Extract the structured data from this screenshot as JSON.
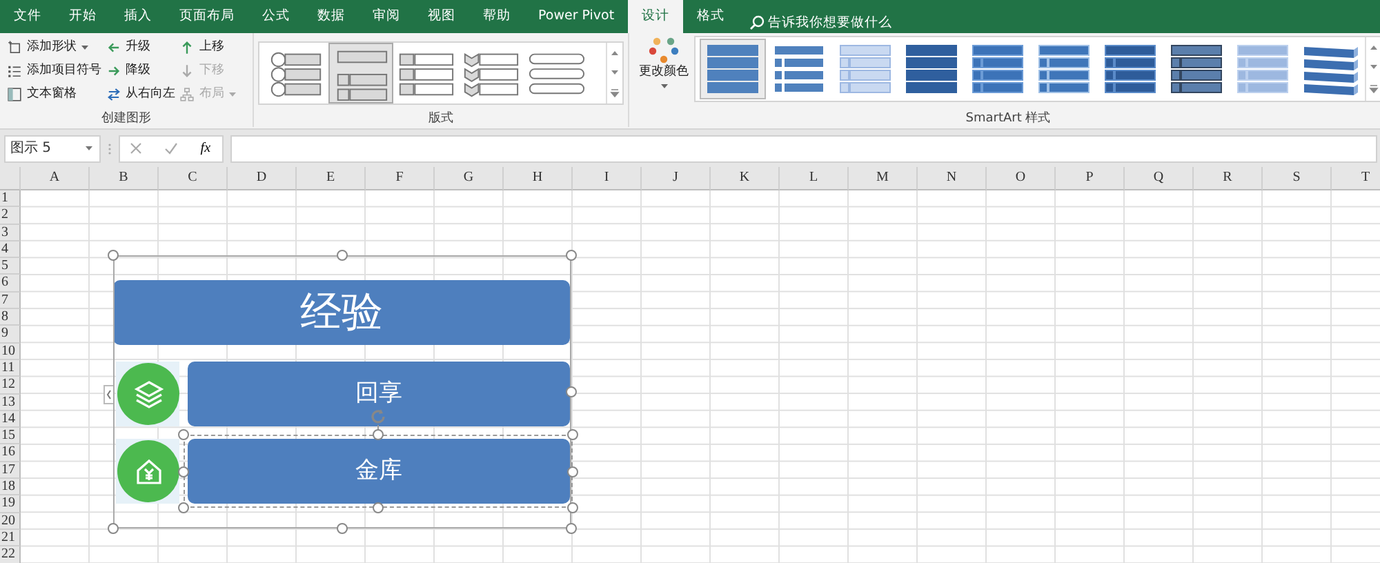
{
  "tabs": [
    {
      "label": "文件",
      "selected": false
    },
    {
      "label": "开始",
      "selected": false
    },
    {
      "label": "插入",
      "selected": false
    },
    {
      "label": "页面布局",
      "selected": false
    },
    {
      "label": "公式",
      "selected": false
    },
    {
      "label": "数据",
      "selected": false
    },
    {
      "label": "审阅",
      "selected": false
    },
    {
      "label": "视图",
      "selected": false
    },
    {
      "label": "帮助",
      "selected": false
    },
    {
      "label": "Power Pivot",
      "selected": false
    },
    {
      "label": "设计",
      "selected": true
    },
    {
      "label": "格式",
      "selected": false
    }
  ],
  "search": {
    "placeholder": "告诉我你想要做什么"
  },
  "create_group": {
    "label": "创建图形",
    "columns": [
      [
        {
          "label": "添加形状",
          "kind": "shape",
          "disabled": false,
          "dropdown": true
        },
        {
          "label": "添加项目符号",
          "kind": "bullets",
          "disabled": false,
          "dropdown": false
        },
        {
          "label": "文本窗格",
          "kind": "pane",
          "disabled": false,
          "dropdown": false
        }
      ],
      [
        {
          "label": "升级",
          "kind": "left",
          "disabled": false,
          "dropdown": false
        },
        {
          "label": "降级",
          "kind": "right",
          "disabled": false,
          "dropdown": false
        },
        {
          "label": "从右向左",
          "kind": "swap",
          "disabled": false,
          "dropdown": false
        }
      ],
      [
        {
          "label": "上移",
          "kind": "up",
          "disabled": false,
          "dropdown": false
        },
        {
          "label": "下移",
          "kind": "down",
          "disabled": true,
          "dropdown": false
        },
        {
          "label": "布局",
          "kind": "org",
          "disabled": true,
          "dropdown": true
        }
      ]
    ]
  },
  "layouts_group": {
    "label": "版式",
    "items": [
      {
        "kind": "circles",
        "selected": false
      },
      {
        "kind": "bars",
        "selected": true
      },
      {
        "kind": "labels",
        "selected": false
      },
      {
        "kind": "chevrons",
        "selected": false
      },
      {
        "kind": "pills",
        "selected": false
      }
    ]
  },
  "styles_group": {
    "label": "SmartArt 样式",
    "change_colors": "更改颜色",
    "items": [
      {
        "kind": "flat",
        "selected": true
      },
      {
        "kind": "outline",
        "selected": false
      },
      {
        "kind": "light",
        "selected": false
      },
      {
        "kind": "dark",
        "selected": false
      },
      {
        "kind": "gloss",
        "selected": false
      },
      {
        "kind": "inset",
        "selected": false
      },
      {
        "kind": "bevel",
        "selected": false
      },
      {
        "kind": "frame",
        "selected": false
      },
      {
        "kind": "faded",
        "selected": false
      },
      {
        "kind": "isometric",
        "selected": false
      }
    ]
  },
  "name_box": "图示 5",
  "formula_fx": "fx",
  "columns": [
    "A",
    "B",
    "C",
    "D",
    "E",
    "F",
    "G",
    "H",
    "I",
    "J",
    "K",
    "L",
    "M",
    "N",
    "O",
    "P",
    "Q",
    "R",
    "S",
    "T"
  ],
  "rows": [
    "1",
    "2",
    "3",
    "4",
    "5",
    "6",
    "7",
    "8",
    "9",
    "10",
    "11",
    "12",
    "13",
    "14",
    "15",
    "16",
    "17",
    "18",
    "19",
    "20",
    "21",
    "22"
  ],
  "smartart": {
    "selected": true,
    "title": "经验",
    "items": [
      {
        "text": "回享",
        "kind": "layers",
        "selected": false
      },
      {
        "text": "金库",
        "kind": "house",
        "selected": true
      }
    ]
  }
}
